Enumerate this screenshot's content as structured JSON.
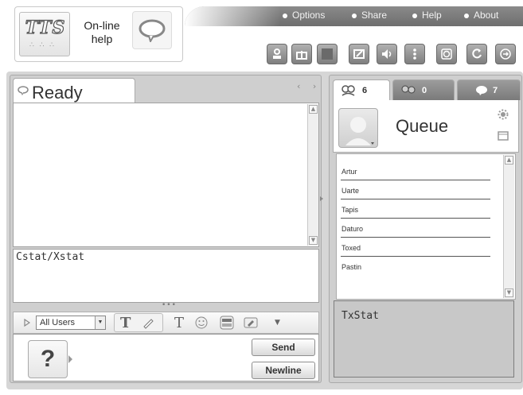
{
  "header": {
    "logo_text": "TTS",
    "online_help": "On-line\nhelp",
    "menu": [
      "Options",
      "Share",
      "Help",
      "About"
    ]
  },
  "toolbar": {
    "icons": [
      "user-icon",
      "gift-icon",
      "stop-icon",
      "edit-icon",
      "speaker-icon",
      "more-icon",
      "history-icon",
      "refresh-icon",
      "exit-icon"
    ]
  },
  "chat": {
    "status_tab": "Ready",
    "stat_text": "Cstat/Xstat",
    "users_select": "All Users",
    "send_label": "Send",
    "newline_label": "Newline",
    "help_symbol": "?"
  },
  "sidebar": {
    "tabs": [
      {
        "count": "6",
        "icon": "users-icon"
      },
      {
        "count": "0",
        "icon": "group-icon"
      },
      {
        "count": "7",
        "icon": "chat-icon"
      }
    ],
    "queue_title": "Queue",
    "queue_items": [
      "Artur",
      "Uarte",
      "Tapis",
      "Daturo",
      "Toxed",
      "Pastin"
    ],
    "tx_stat": "TxStat"
  },
  "colors": {
    "topbar": "#7a7a7a",
    "panel_bg": "#cfcfcf",
    "tab_inactive": "#8a8a8a"
  }
}
